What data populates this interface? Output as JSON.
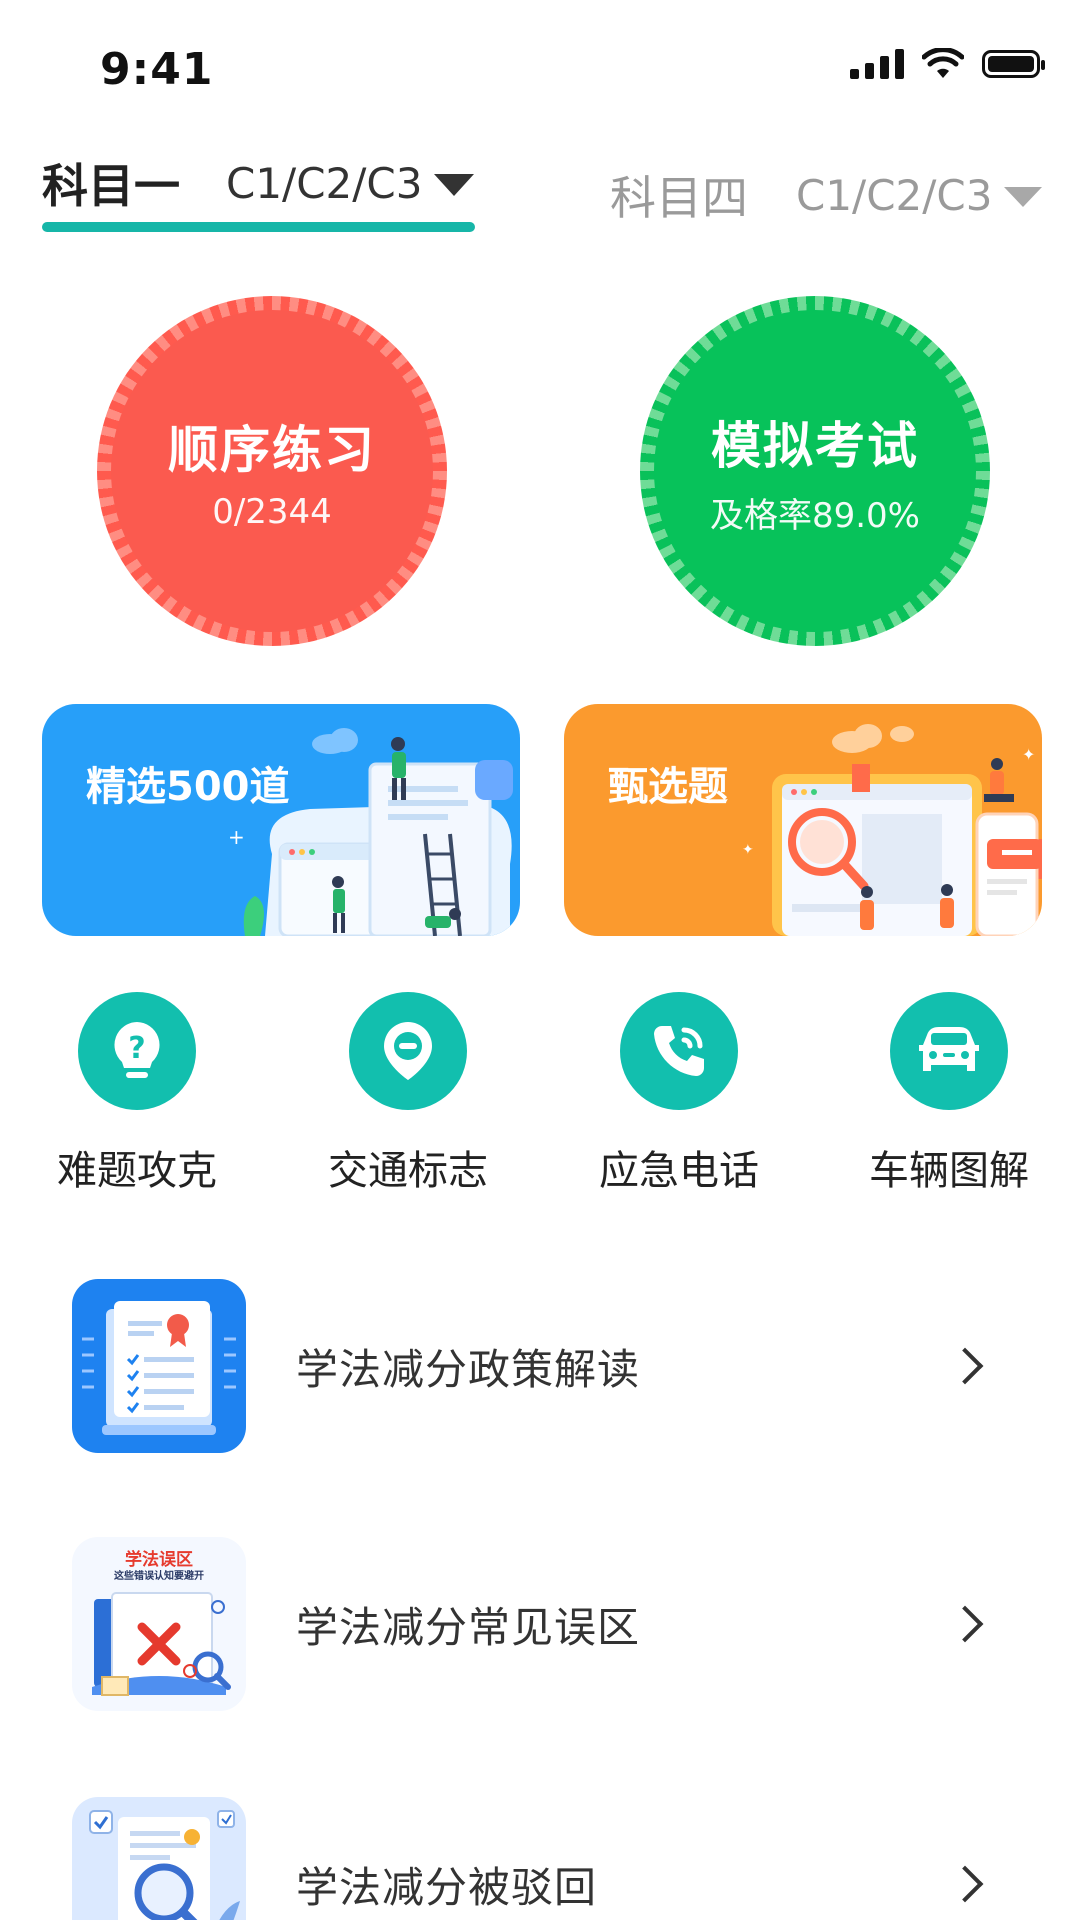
{
  "status_bar": {
    "time": "9:41"
  },
  "tabs": {
    "active": {
      "title": "科目一",
      "license": "C1/C2/C3"
    },
    "inactive": {
      "title": "科目四",
      "license": "C1/C2/C3"
    },
    "accent_color": "#16b6a8"
  },
  "practice": {
    "sequential": {
      "title": "顺序练习",
      "progress_text": "0/2344",
      "progress": 0,
      "color": "#fb5a4f"
    },
    "mock_exam": {
      "title": "模拟考试",
      "pass_rate_text": "及格率89.0%",
      "color": "#07c25a"
    }
  },
  "banners": [
    {
      "title": "精选500道",
      "color": "#279ff9"
    },
    {
      "title": "甄选题",
      "color": "#fb9a2e"
    }
  ],
  "quick_actions": [
    {
      "label": "难题攻克",
      "icon": "lightbulb-question-icon"
    },
    {
      "label": "交通标志",
      "icon": "no-entry-sign-icon"
    },
    {
      "label": "应急电话",
      "icon": "phone-call-icon"
    },
    {
      "label": "车辆图解",
      "icon": "car-icon"
    }
  ],
  "list": [
    {
      "title": "学法减分政策解读"
    },
    {
      "title": "学法减分常见误区",
      "thumb_caption": "学法误区",
      "thumb_subcaption": "这些错误认知要避开"
    },
    {
      "title": "学法减分被驳回"
    }
  ]
}
